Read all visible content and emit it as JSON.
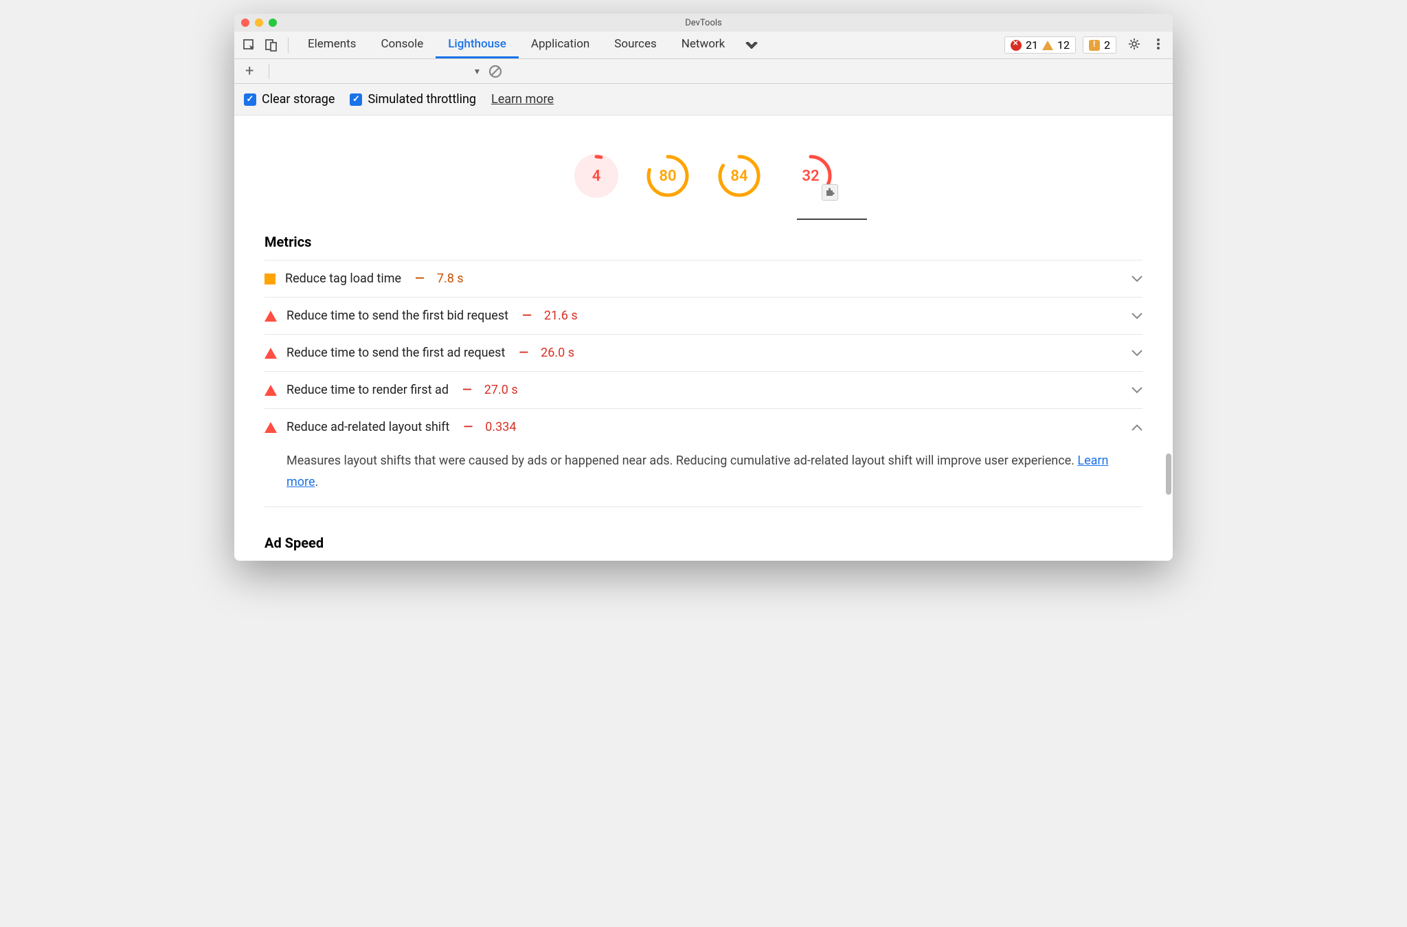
{
  "window": {
    "title": "DevTools"
  },
  "tabs": {
    "items": [
      "Elements",
      "Console",
      "Lighthouse",
      "Application",
      "Sources",
      "Network"
    ],
    "active_index": 2
  },
  "badges": {
    "errors": "21",
    "warnings": "12",
    "issues": "2"
  },
  "options": {
    "clear_storage": "Clear storage",
    "simulated_throttling": "Simulated throttling",
    "learn_more": "Learn more"
  },
  "gauges": [
    {
      "score": "4",
      "color": "red",
      "pct": 4
    },
    {
      "score": "80",
      "color": "orange",
      "pct": 80
    },
    {
      "score": "84",
      "color": "orange",
      "pct": 84
    },
    {
      "score": "32",
      "color": "red",
      "pct": 32,
      "plugin": true
    }
  ],
  "metrics": {
    "title": "Metrics",
    "items": [
      {
        "icon": "square",
        "label": "Reduce tag load time",
        "value": "7.8 s",
        "color": "orange",
        "expanded": false
      },
      {
        "icon": "tri",
        "label": "Reduce time to send the first bid request",
        "value": "21.6 s",
        "color": "red",
        "expanded": false
      },
      {
        "icon": "tri",
        "label": "Reduce time to send the first ad request",
        "value": "26.0 s",
        "color": "red",
        "expanded": false
      },
      {
        "icon": "tri",
        "label": "Reduce time to render first ad",
        "value": "27.0 s",
        "color": "red",
        "expanded": false
      },
      {
        "icon": "tri",
        "label": "Reduce ad-related layout shift",
        "value": "0.334",
        "color": "red",
        "expanded": true,
        "desc_pre": "Measures layout shifts that were caused by ads or happened near ads. Reducing cumulative ad-related layout shift will improve user experience. ",
        "desc_link": "Learn more",
        "desc_post": "."
      }
    ]
  },
  "ad_speed": {
    "title": "Ad Speed"
  }
}
